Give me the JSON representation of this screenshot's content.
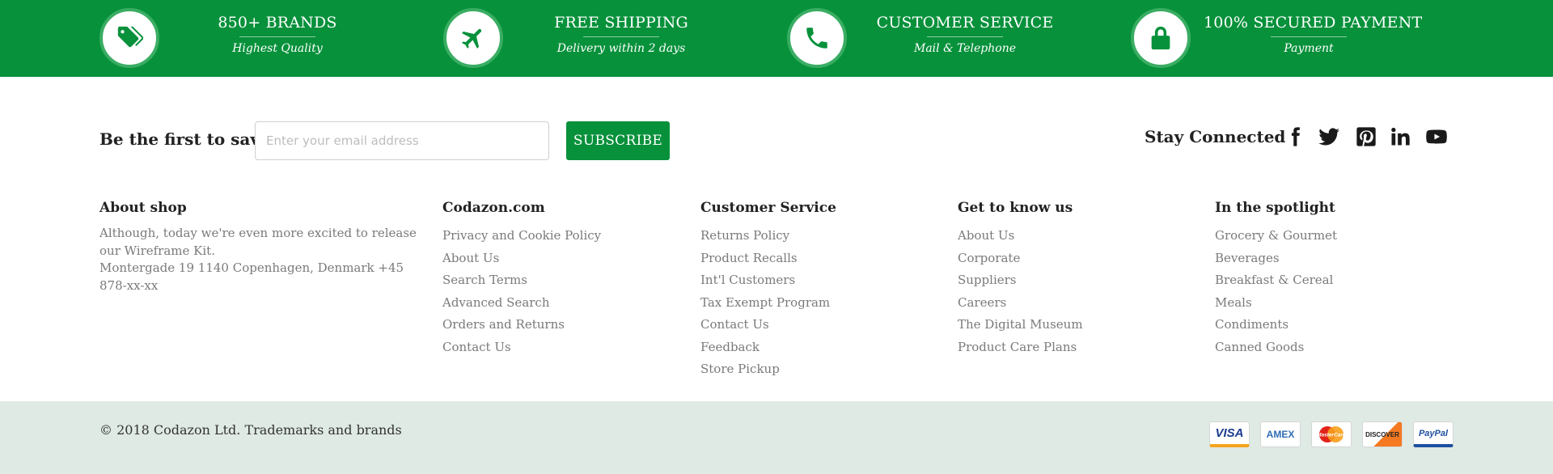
{
  "features": [
    {
      "icon": "tag-icon",
      "title": "850+ BRANDS",
      "subtitle": "Highest Quality"
    },
    {
      "icon": "airplane-icon",
      "title": "FREE SHIPPING",
      "subtitle": "Delivery within 2 days"
    },
    {
      "icon": "phone-icon",
      "title": "CUSTOMER SERVICE",
      "subtitle": "Mail & Telephone"
    },
    {
      "icon": "lock-icon",
      "title": "100% SECURED PAYMENT",
      "subtitle": "Payment"
    }
  ],
  "newsletter": {
    "label": "Be the first to save!",
    "placeholder": "Enter your email address",
    "value": "",
    "button": "SUBSCRIBE"
  },
  "social": {
    "label": "Stay Connected",
    "icons": [
      "facebook-icon",
      "twitter-icon",
      "pinterest-icon",
      "linkedin-icon",
      "youtube-icon"
    ]
  },
  "columns": {
    "about": {
      "title": "About shop",
      "text1": "Although, today we're even more excited to release our Wireframe Kit.",
      "text2": "Montergade 19 1140 Copenhagen, Denmark +45 878-xx-xx"
    },
    "codazon": {
      "title": "Codazon.com",
      "links": [
        "Privacy and Cookie Policy",
        "About Us",
        "Search Terms",
        "Advanced Search",
        "Orders and Returns",
        "Contact Us"
      ]
    },
    "customer_service": {
      "title": "Customer Service",
      "links": [
        "Returns Policy",
        "Product Recalls",
        "Int'l Customers",
        "Tax Exempt Program",
        "Contact Us",
        "Feedback",
        "Store Pickup"
      ]
    },
    "know_us": {
      "title": "Get to know us",
      "links": [
        "About Us",
        "Corporate",
        "Suppliers",
        "Careers",
        "The Digital Museum",
        "Product Care Plans"
      ]
    },
    "spotlight": {
      "title": "In the spotlight",
      "links": [
        "Grocery & Gourmet",
        "Beverages",
        "Breakfast & Cereal",
        "Meals",
        "Condiments",
        "Canned Goods"
      ]
    }
  },
  "bottom": {
    "copyright": "© 2018 Codazon Ltd. Trademarks and brands",
    "payments": [
      "VISA",
      "AMEX",
      "MasterCard",
      "DISCOVER",
      "PayPal"
    ]
  },
  "colors": {
    "brand_green": "#07913b",
    "bottom_bg": "#dfeae4"
  }
}
